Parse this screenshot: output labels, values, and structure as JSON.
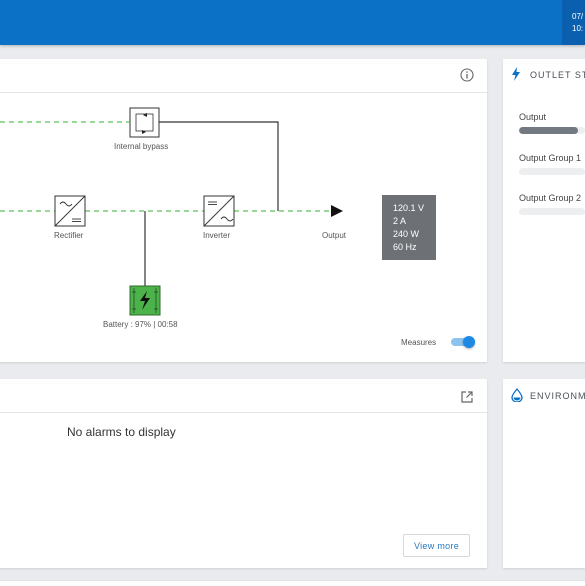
{
  "header": {
    "date_line1": "07/",
    "date_line2": "10:"
  },
  "synoptic": {
    "labels": {
      "internal_bypass": "Internal bypass",
      "rectifier": "Rectifier",
      "inverter": "Inverter",
      "output": "Output",
      "battery": "Battery : 97% | 00:58"
    },
    "measures": {
      "voltage": "120.1 V",
      "current": "2 A",
      "power": "240 W",
      "frequency": "60 Hz"
    },
    "toggle_label": "Measures",
    "toggle_on": true,
    "colors": {
      "battery": "#4cb34a",
      "flow_line": "#5cc05a",
      "toggle": "#1e88e5"
    }
  },
  "alarms": {
    "empty_text": "No alarms to display",
    "view_more_label": "View more"
  },
  "outlet_status": {
    "title": "OUTLET STA",
    "items": [
      {
        "label": "Output",
        "level": 0.9
      },
      {
        "label": "Output Group 1",
        "level": 0
      },
      {
        "label": "Output Group 2",
        "level": 0
      }
    ]
  },
  "environment": {
    "title": "ENVIRONME"
  }
}
